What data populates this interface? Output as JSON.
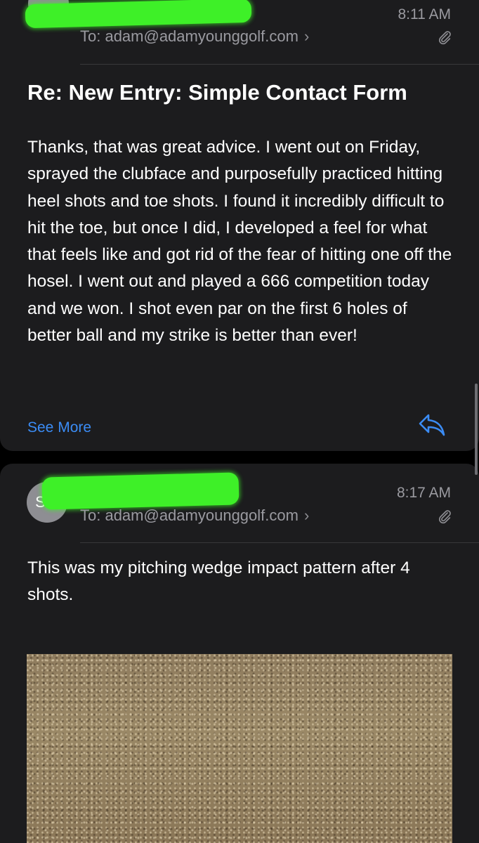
{
  "colors": {
    "background": "#000000",
    "card": "#1c1c1e",
    "accent": "#3b8cf5",
    "secondary_text": "#9a9aa0",
    "redaction": "#3ef028"
  },
  "message_1": {
    "avatar_icon": "avatar-icon",
    "to_label": "To: adam@adamyounggolf.com",
    "time": "8:11 AM",
    "attachment_icon": "paperclip-icon",
    "subject": "Re: New Entry: Simple Contact Form",
    "body": "Thanks, that was great advice. I went out on Friday, sprayed the clubface and purposefully practiced hitting heel shots and toe shots. I found it incredibly difficult to hit the toe, but once I did, I developed a feel for what that feels like and got rid of the fear of hitting one off the hosel. I went out and played a 666 competition today and we won. I shot even par on the first 6 holes of better ball and my strike is better than ever!",
    "see_more_label": "See More",
    "reply_icon": "reply-icon"
  },
  "message_2": {
    "avatar_initials": "SG",
    "to_label": "To: adam@adamyounggolf.com",
    "time": "8:17 AM",
    "attachment_icon": "paperclip-icon",
    "body": "This was my pitching wedge impact pattern after 4 shots.",
    "image_icon": "photo-image"
  }
}
